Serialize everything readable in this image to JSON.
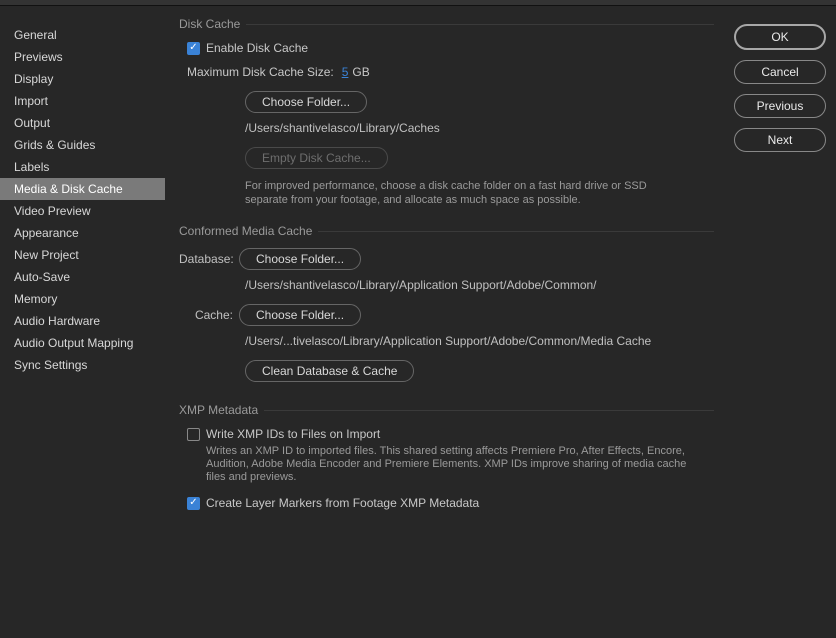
{
  "sidebar": {
    "items": [
      "General",
      "Previews",
      "Display",
      "Import",
      "Output",
      "Grids & Guides",
      "Labels",
      "Media & Disk Cache",
      "Video Preview",
      "Appearance",
      "New Project",
      "Auto-Save",
      "Memory",
      "Audio Hardware",
      "Audio Output Mapping",
      "Sync Settings"
    ],
    "selected": "Media & Disk Cache"
  },
  "diskCache": {
    "title": "Disk Cache",
    "enableLabel": "Enable Disk Cache",
    "enableChecked": true,
    "maxSizeLabel": "Maximum Disk Cache Size:",
    "maxSizeValue": "5",
    "maxSizeUnit": "GB",
    "chooseFolder": "Choose Folder...",
    "path": "/Users/shantivelasco/Library/Caches",
    "emptyLabel": "Empty Disk Cache...",
    "emptyEnabled": false,
    "help": "For improved performance, choose a disk cache folder on a fast hard drive or SSD separate from your footage, and allocate as much space as possible."
  },
  "conformed": {
    "title": "Conformed Media Cache",
    "databaseLabel": "Database:",
    "cacheLabel": "Cache:",
    "chooseFolder": "Choose Folder...",
    "databasePath": "/Users/shantivelasco/Library/Application Support/Adobe/Common/",
    "cachePath": "/Users/...tivelasco/Library/Application Support/Adobe/Common/Media Cache",
    "cleanLabel": "Clean Database & Cache"
  },
  "xmp": {
    "title": "XMP Metadata",
    "writeLabel": "Write XMP IDs to Files on Import",
    "writeChecked": false,
    "writeHelp": "Writes an XMP ID to imported files. This shared setting affects Premiere Pro, After Effects, Encore, Audition, Adobe Media Encoder and Premiere Elements. XMP IDs improve sharing of media cache files and previews.",
    "layerMarkersLabel": "Create Layer Markers from Footage XMP Metadata",
    "layerMarkersChecked": true
  },
  "buttons": {
    "ok": "OK",
    "cancel": "Cancel",
    "previous": "Previous",
    "next": "Next"
  }
}
